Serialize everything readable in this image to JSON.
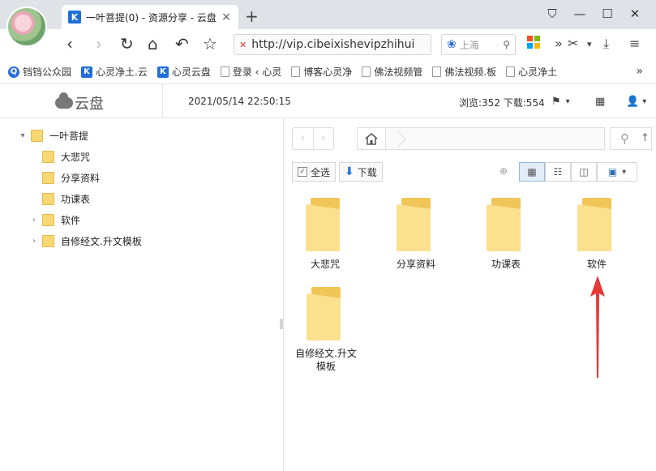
{
  "browser": {
    "tab_title": "一叶菩提(0) - 资源分享 - 云盘",
    "tab_close": "×",
    "new_tab": "+",
    "address": "http://vip.cibeixishevipzhihui",
    "address_warning": "✕",
    "search_placeholder": "上海",
    "win_controls": [
      "⛉",
      "—",
      "☐",
      "✕"
    ],
    "nav": {
      "back": "‹",
      "forward": "›",
      "reload": "↻",
      "home": "⌂",
      "undo": "↶",
      "star": "☆"
    },
    "right_tools": {
      "more": "»",
      "cut": "✂",
      "drop": "▾",
      "download": "⤓",
      "menu": "≡"
    }
  },
  "bookmarks": {
    "items": [
      {
        "label": "铛铛公众园",
        "icon": "q-icon"
      },
      {
        "label": "心灵净土.云",
        "icon": "k-icon"
      },
      {
        "label": "心灵云盘",
        "icon": "k-icon"
      },
      {
        "label": "登录 ‹ 心灵",
        "icon": "page-icon"
      },
      {
        "label": "博客心灵净",
        "icon": "page-icon"
      },
      {
        "label": "佛法视频管",
        "icon": "page-icon"
      },
      {
        "label": "佛法视频.板",
        "icon": "page-icon"
      },
      {
        "label": "心灵净土",
        "icon": "page-icon"
      }
    ],
    "more": "»"
  },
  "app": {
    "logo_text": "云盘",
    "datetime": "2021/05/14 22:50:15",
    "stats": "浏览:352 下载:554"
  },
  "tree": {
    "root": "一叶菩提",
    "children": [
      {
        "label": "大悲咒",
        "expandable": false
      },
      {
        "label": "分享资料",
        "expandable": false
      },
      {
        "label": "功课表",
        "expandable": false
      },
      {
        "label": "软件",
        "expandable": true
      },
      {
        "label": "自修经文.升文模板",
        "expandable": true
      }
    ]
  },
  "toolbar": {
    "select_all": "全选",
    "download": "下载"
  },
  "files": [
    {
      "label": "大悲咒"
    },
    {
      "label": "分享资料"
    },
    {
      "label": "功课表"
    },
    {
      "label": "软件"
    },
    {
      "label": "自修经文.升文模板"
    }
  ],
  "colors": {
    "annotation_arrow": "#e53935",
    "folder": "#f8d775",
    "accent": "#1e6fd9"
  }
}
